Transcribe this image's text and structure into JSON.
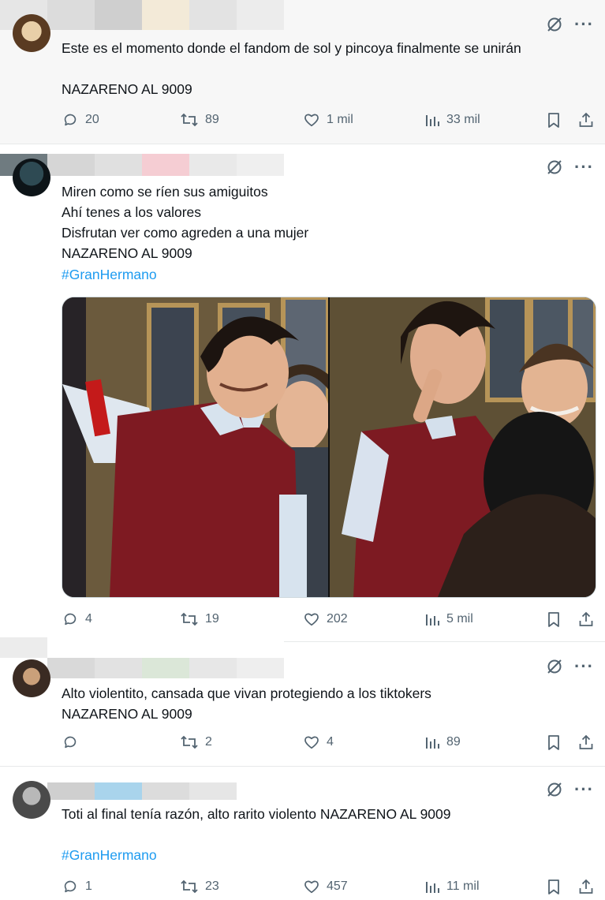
{
  "tweets": [
    {
      "lines": "Este es el momento donde el fandom de sol y pincoya finalmente se unirán\n\nNAZARENO AL 9009",
      "stats": {
        "replies": "20",
        "retweets": "89",
        "likes": "1 mil",
        "views": "33 mil"
      }
    },
    {
      "lines": "Miren como se ríen sus amiguitos\nAhí tenes a los valores\nDisfrutan ver como agreden a una mujer\nNAZARENO AL 9009",
      "hashtag": "#GranHermano",
      "stats": {
        "replies": "4",
        "retweets": "19",
        "likes": "202",
        "views": "5 mil"
      }
    },
    {
      "lines": "Alto violentito, cansada que vivan protegiendo a los tiktokers\nNAZARENO AL 9009",
      "stats": {
        "replies": "",
        "retweets": "2",
        "likes": "4",
        "views": "89"
      }
    },
    {
      "lines": "Toti al final tenía razón, alto rarito violento NAZARENO AL 9009",
      "hashtag": "#GranHermano",
      "stats": {
        "replies": "1",
        "retweets": "23",
        "likes": "457",
        "views": "11 mil"
      }
    }
  ],
  "icons": {
    "reply": "reply-icon",
    "retweet": "retweet-icon",
    "like": "heart-icon",
    "views": "views-chart-icon",
    "bookmark": "bookmark-icon",
    "share": "share-icon",
    "grok": "grok-icon",
    "more": "more-icon"
  },
  "colors": {
    "text": "#0f1419",
    "muted": "#536471",
    "link": "#1d9bf0",
    "border": "#e7e9ea"
  }
}
